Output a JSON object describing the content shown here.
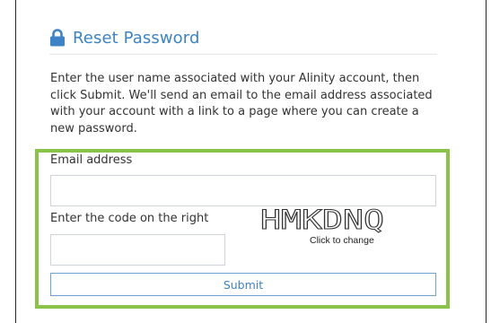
{
  "header": {
    "title": "Reset Password",
    "icon": "lock-icon",
    "accent_color": "#3d84c6"
  },
  "description": "Enter the user name associated with your Alinity account, then click Submit. We'll send an email to the email address associated with your account with a link to a page where you can create a new password.",
  "form": {
    "email_label": "Email address",
    "email_value": "",
    "code_label": "Enter the code on the right",
    "code_value": "",
    "captcha_text": "HMKDNQ",
    "captcha_hint": "Click to change",
    "submit_label": "Submit"
  },
  "highlight_color": "#8bc34a"
}
